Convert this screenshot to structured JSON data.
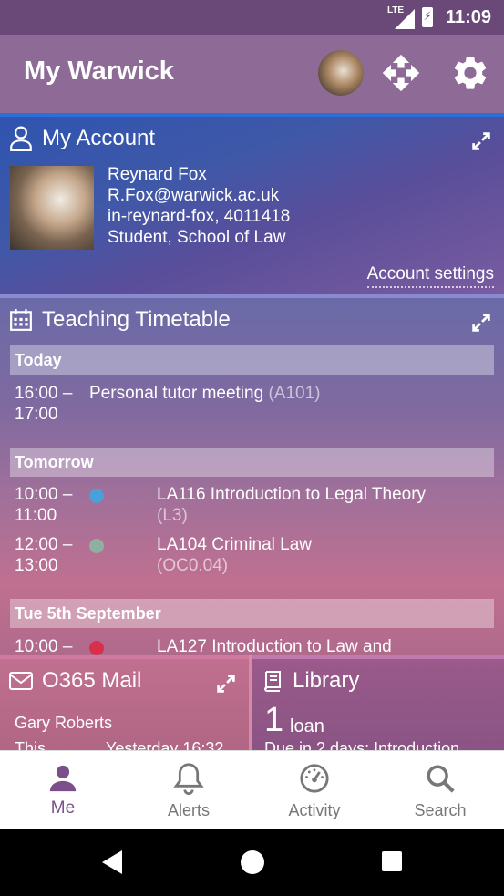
{
  "status_bar": {
    "network": "LTE",
    "time": "11:09"
  },
  "app_bar": {
    "title": "My Warwick"
  },
  "account": {
    "title": "My Account",
    "name": "Reynard Fox",
    "email": "R.Fox@warwick.ac.uk",
    "user_id": "in-reynard-fox, 4011418",
    "role": "Student, School of Law",
    "settings_link": "Account settings"
  },
  "timetable": {
    "title": "Teaching Timetable",
    "days": [
      {
        "label": "Today",
        "events": [
          {
            "start": "16:00 –",
            "end": "17:00",
            "name": "Personal tutor meeting",
            "room": "(A101)",
            "color": ""
          }
        ]
      },
      {
        "label": "Tomorrow",
        "events": [
          {
            "start": "10:00 –",
            "end": "11:00",
            "name": "LA116 Introduction to Legal Theory",
            "room": "(L3)",
            "color": "#4aa0d8"
          },
          {
            "start": "12:00 –",
            "end": "13:00",
            "name": "LA104 Criminal Law",
            "room": "(OC0.04)",
            "color": "#8fb0a0"
          }
        ]
      },
      {
        "label": "Tue 5th September",
        "events": [
          {
            "start": "10:00 –",
            "end": "",
            "name": "LA127 Introduction to Law and",
            "room": "",
            "color": "#d8304a"
          }
        ]
      }
    ]
  },
  "mail": {
    "title": "O365 Mail",
    "sender": "Gary Roberts",
    "preview": "This",
    "time": "Yesterday 16:32"
  },
  "library": {
    "title": "Library",
    "count": "1",
    "count_label": "loan",
    "detail": "Due in 2 days: Introduction"
  },
  "bottom_nav": {
    "items": [
      {
        "label": "Me"
      },
      {
        "label": "Alerts"
      },
      {
        "label": "Activity"
      },
      {
        "label": "Search"
      }
    ]
  },
  "colors": {
    "accent": "#7a4f8a",
    "account_border": "#2c6fd8"
  }
}
